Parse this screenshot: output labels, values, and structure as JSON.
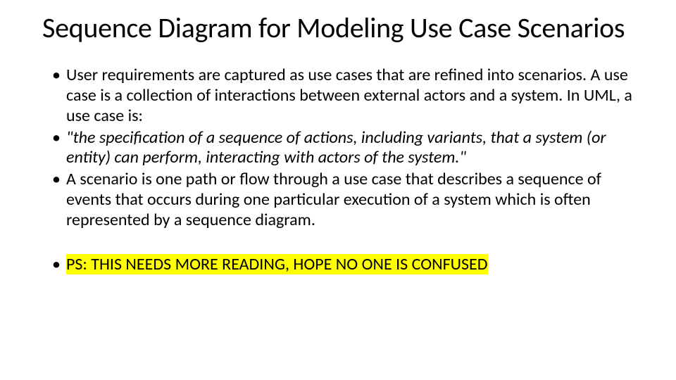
{
  "title": "Sequence Diagram for Modeling Use Case Scenarios",
  "bullets": {
    "b1": "User requirements are captured as use cases that are refined into scenarios. A use case is a collection of interactions between external actors and a system. In UML, a use case is:",
    "b2": "\"the specification of a sequence of actions, including variants, that a system (or entity) can perform, interacting with actors of the system.\"",
    "b3": "A scenario is one path or flow through a use case that describes a sequence of events that occurs during one particular execution of a system which is often represented by a sequence diagram.",
    "b4": "PS: THIS NEEDS MORE READING, HOPE NO ONE IS CONFUSED"
  }
}
